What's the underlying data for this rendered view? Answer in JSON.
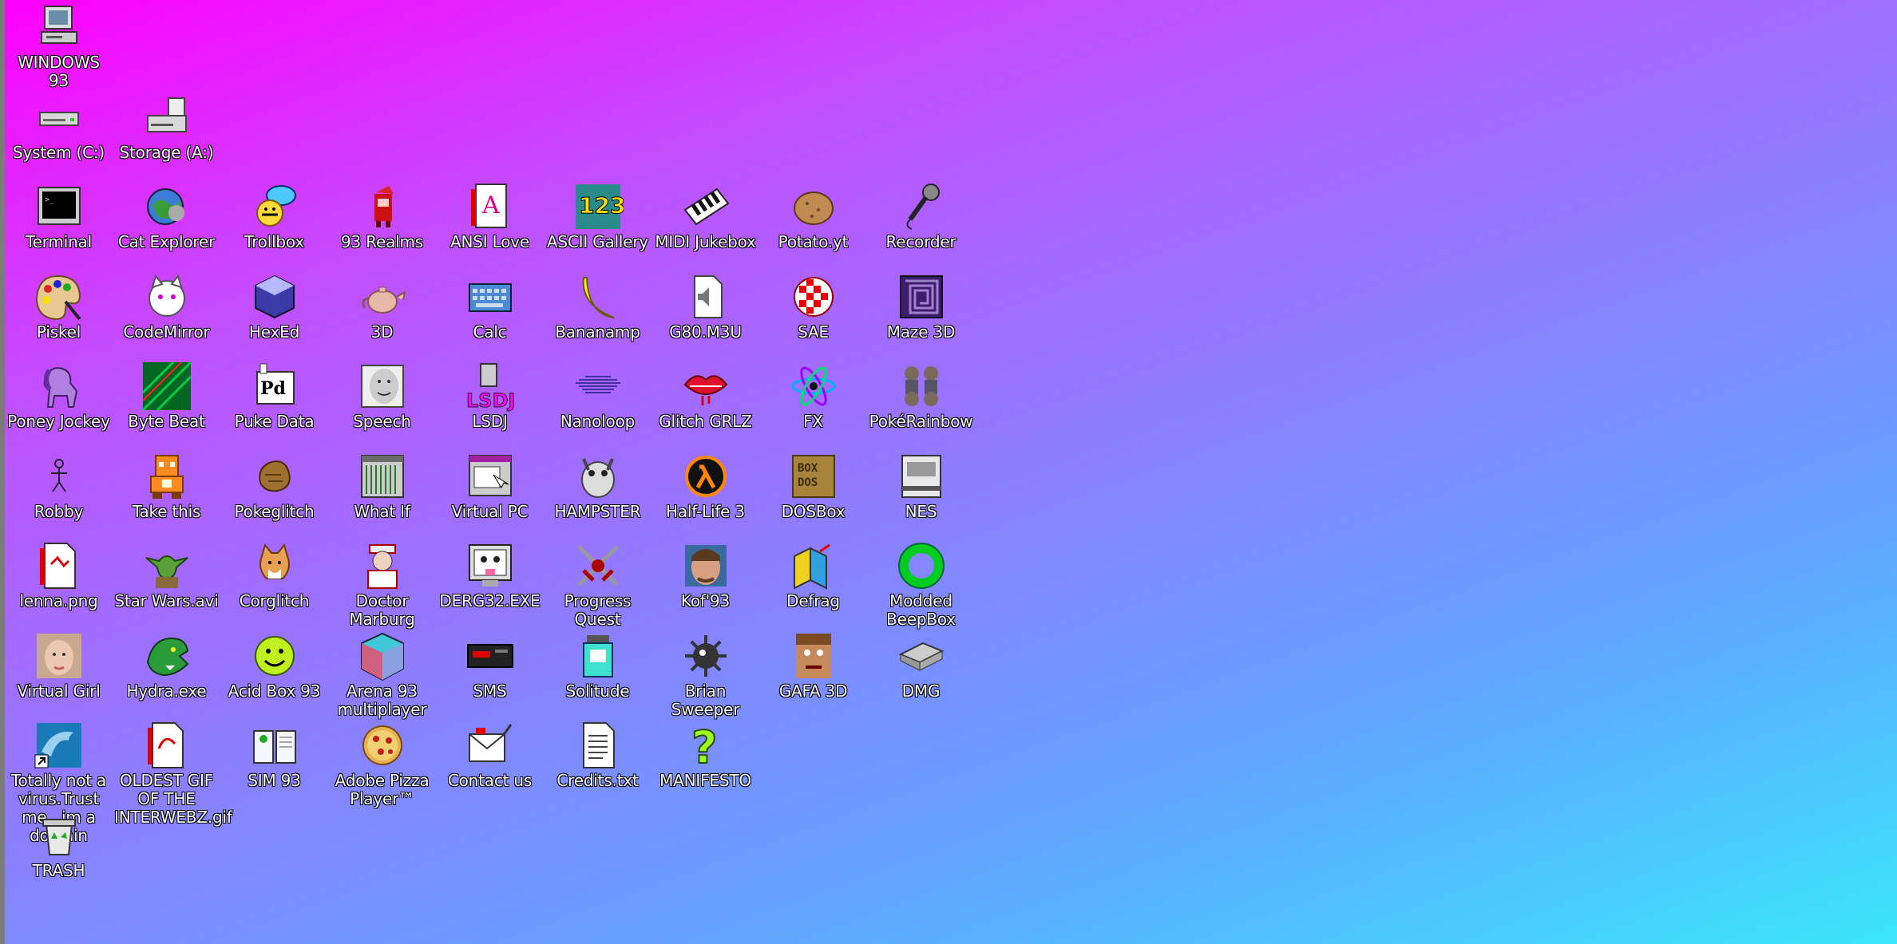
{
  "desktop": {
    "icons": [
      {
        "label": "WINDOWS 93",
        "icon": "computer-icon"
      },
      {
        "label": "System (C:)",
        "icon": "hard-drive-icon"
      },
      {
        "label": "Storage (A:)",
        "icon": "storage-drive-icon"
      },
      {
        "label": "Terminal",
        "icon": "terminal-icon"
      },
      {
        "label": "Cat Explorer",
        "icon": "cat-globe-icon"
      },
      {
        "label": "Trollbox",
        "icon": "trollbox-chat-icon"
      },
      {
        "label": "93 Realms",
        "icon": "red-mage-icon"
      },
      {
        "label": "ANSI Love",
        "icon": "ansi-letter-icon"
      },
      {
        "label": "ASCII Gallery",
        "icon": "ascii-numbers-icon"
      },
      {
        "label": "MIDI Jukebox",
        "icon": "piano-keys-icon"
      },
      {
        "label": "Potato.yt",
        "icon": "potato-icon"
      },
      {
        "label": "Recorder",
        "icon": "microphone-icon"
      },
      {
        "label": "Piskel",
        "icon": "paint-palette-icon"
      },
      {
        "label": "CodeMirror",
        "icon": "white-cat-icon"
      },
      {
        "label": "HexEd",
        "icon": "hex-cube-icon"
      },
      {
        "label": "3D",
        "icon": "teapot-icon"
      },
      {
        "label": "Calc",
        "icon": "keyboard-icon"
      },
      {
        "label": "Bananamp",
        "icon": "banana-icon"
      },
      {
        "label": "G80.M3U",
        "icon": "audio-file-icon"
      },
      {
        "label": "SAE",
        "icon": "checkered-ball-icon"
      },
      {
        "label": "Maze 3D",
        "icon": "maze-icon"
      },
      {
        "label": "Poney Jockey",
        "icon": "pony-icon"
      },
      {
        "label": "Byte Beat",
        "icon": "byte-beat-icon"
      },
      {
        "label": "Puke Data",
        "icon": "puke-data-icon"
      },
      {
        "label": "Speech",
        "icon": "speech-face-icon"
      },
      {
        "label": "LSDJ",
        "icon": "lsdj-icon"
      },
      {
        "label": "Nanoloop",
        "icon": "nanoloop-wave-icon"
      },
      {
        "label": "Glitch GRLZ",
        "icon": "lips-icon"
      },
      {
        "label": "FX",
        "icon": "atom-icon"
      },
      {
        "label": "PokéRainbow",
        "icon": "trainers-icon"
      },
      {
        "label": "Robby",
        "icon": "stick-figure-icon"
      },
      {
        "label": "Take this",
        "icon": "orange-character-icon"
      },
      {
        "label": "Pokeglitch",
        "icon": "glitch-rock-icon"
      },
      {
        "label": "What If",
        "icon": "what-if-window-icon"
      },
      {
        "label": "Virtual PC",
        "icon": "virtual-pc-icon"
      },
      {
        "label": "HAMPSTER",
        "icon": "hamster-icon"
      },
      {
        "label": "Half-Life 3",
        "icon": "lambda-icon"
      },
      {
        "label": "DOSBox",
        "icon": "dosbox-icon"
      },
      {
        "label": "NES",
        "icon": "nes-console-icon"
      },
      {
        "label": "lenna.png",
        "icon": "image-file-icon"
      },
      {
        "label": "Star Wars.avi",
        "icon": "yoda-icon"
      },
      {
        "label": "Corglitch",
        "icon": "corgi-icon"
      },
      {
        "label": "Doctor Marburg",
        "icon": "doctor-icon"
      },
      {
        "label": "DERG32.EXE",
        "icon": "derg-monitor-icon"
      },
      {
        "label": "Progress Quest",
        "icon": "crossed-swords-icon"
      },
      {
        "label": "Kof'93",
        "icon": "fighter-face-icon"
      },
      {
        "label": "Defrag",
        "icon": "defrag-icon"
      },
      {
        "label": "Modded BeepBox",
        "icon": "green-ring-icon"
      },
      {
        "label": "Virtual Girl",
        "icon": "girl-face-icon"
      },
      {
        "label": "Hydra.exe",
        "icon": "green-dragon-icon"
      },
      {
        "label": "Acid Box 93",
        "icon": "acid-smiley-icon"
      },
      {
        "label": "Arena 93 multiplayer",
        "icon": "arena-cube-icon"
      },
      {
        "label": "SMS",
        "icon": "sms-console-icon"
      },
      {
        "label": "Solitude",
        "icon": "jar-icon"
      },
      {
        "label": "Brian Sweeper",
        "icon": "mine-icon"
      },
      {
        "label": "GAFA 3D",
        "icon": "doom-face-icon"
      },
      {
        "label": "DMG",
        "icon": "dmg-device-icon"
      },
      {
        "label": "Totally not a virus.Trust me...im a dolphin",
        "icon": "dolphin-shortcut-icon"
      },
      {
        "label": "OLDEST GIF OF THE INTERWEBZ.gif",
        "icon": "gif-file-icon"
      },
      {
        "label": "SIM 93",
        "icon": "sim-book-icon"
      },
      {
        "label": "Adobe Pizza Player™",
        "icon": "pizza-icon"
      },
      {
        "label": "Contact us",
        "icon": "contact-letter-icon"
      },
      {
        "label": "Credits.txt",
        "icon": "text-file-icon"
      },
      {
        "label": "MANIFESTO",
        "icon": "question-mark-icon"
      },
      {
        "label": "TRASH",
        "icon": "trash-icon"
      }
    ]
  },
  "colors": {
    "gradient": [
      "#ff00ff",
      "#c050ff",
      "#8f7cff",
      "#60a6ff",
      "#3ae6fb"
    ],
    "label_text": "#ffffff",
    "label_outline": "#000000"
  }
}
